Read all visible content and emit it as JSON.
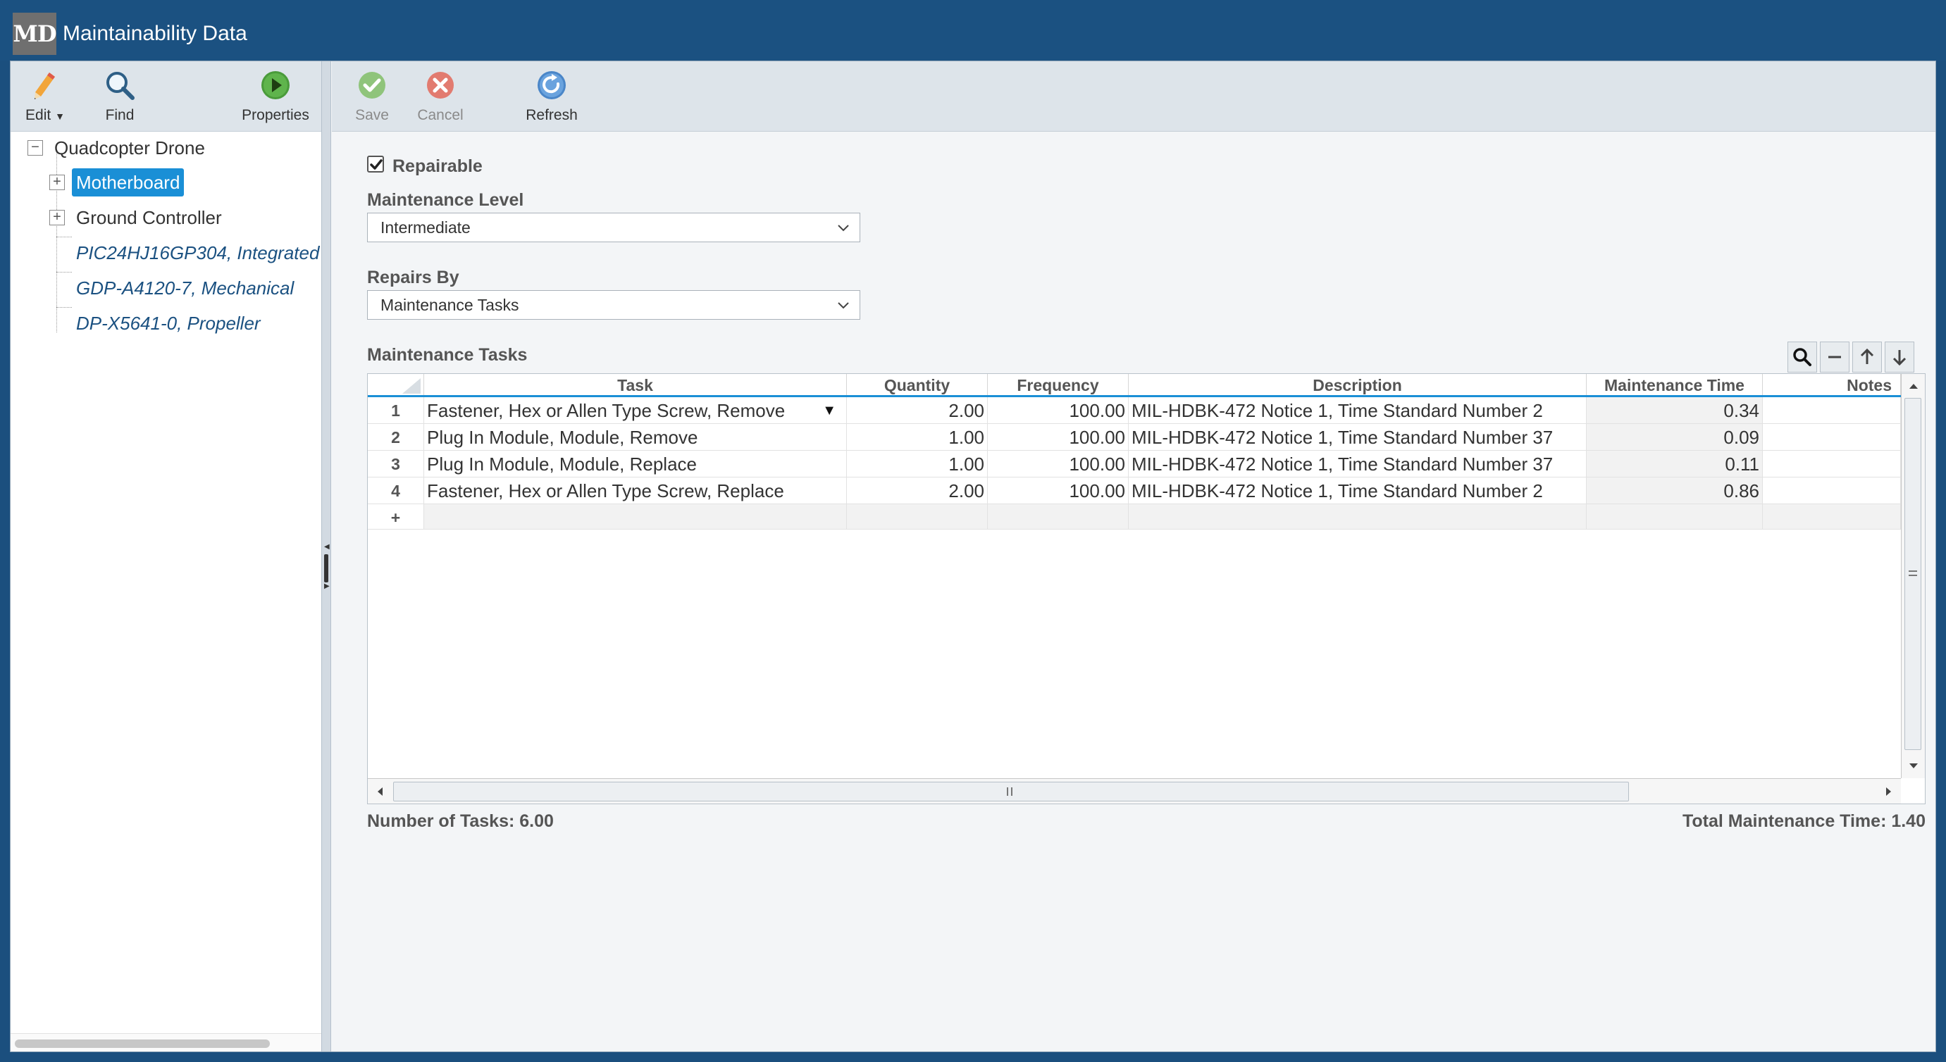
{
  "app": {
    "logo": "MD",
    "title": "Maintainability Data"
  },
  "left_toolbar": {
    "edit_label": "Edit",
    "find_label": "Find",
    "properties_label": "Properties"
  },
  "right_toolbar": {
    "save_label": "Save",
    "cancel_label": "Cancel",
    "refresh_label": "Refresh"
  },
  "tree": {
    "root": "Quadcopter Drone",
    "children": [
      {
        "label": "Motherboard",
        "selected": true,
        "expandable": true
      },
      {
        "label": "Ground Controller",
        "expandable": true
      },
      {
        "label": "PIC24HJ16GP304, Integrated",
        "leaf": true
      },
      {
        "label": "GDP-A4120-7, Mechanical",
        "leaf": true
      },
      {
        "label": "DP-X5641-0, Propeller",
        "leaf": true
      }
    ]
  },
  "form": {
    "repairable_label": "Repairable",
    "repairable_checked": true,
    "maintenance_level_label": "Maintenance Level",
    "maintenance_level_value": "Intermediate",
    "repairs_by_label": "Repairs By",
    "repairs_by_value": "Maintenance Tasks",
    "tasks_section_label": "Maintenance Tasks"
  },
  "grid": {
    "columns": [
      "Task",
      "Quantity",
      "Frequency",
      "Description",
      "Maintenance Time",
      "Notes"
    ],
    "rows": [
      {
        "n": "1",
        "task": "Fastener, Hex or Allen Type Screw, Remove",
        "quantity": "2.00",
        "frequency": "100.00",
        "description": "MIL-HDBK-472 Notice 1, Time Standard Number 2",
        "time": "0.34",
        "notes": ""
      },
      {
        "n": "2",
        "task": "Plug In Module, Module, Remove",
        "quantity": "1.00",
        "frequency": "100.00",
        "description": "MIL-HDBK-472 Notice 1, Time Standard Number 37",
        "time": "0.09",
        "notes": ""
      },
      {
        "n": "3",
        "task": "Plug In Module, Module, Replace",
        "quantity": "1.00",
        "frequency": "100.00",
        "description": "MIL-HDBK-472 Notice 1, Time Standard Number 37",
        "time": "0.11",
        "notes": ""
      },
      {
        "n": "4",
        "task": "Fastener, Hex or Allen Type Screw, Replace",
        "quantity": "2.00",
        "frequency": "100.00",
        "description": "MIL-HDBK-472 Notice 1, Time Standard Number 2",
        "time": "0.86",
        "notes": ""
      }
    ],
    "add_row_symbol": "+"
  },
  "footer": {
    "task_count": "Number of Tasks: 6.00",
    "total_time": "Total Maintenance Time: 1.40"
  },
  "colors": {
    "title_bar": "#1b5181",
    "selection": "#1a8fd6",
    "toolbar": "#dde4ea"
  }
}
